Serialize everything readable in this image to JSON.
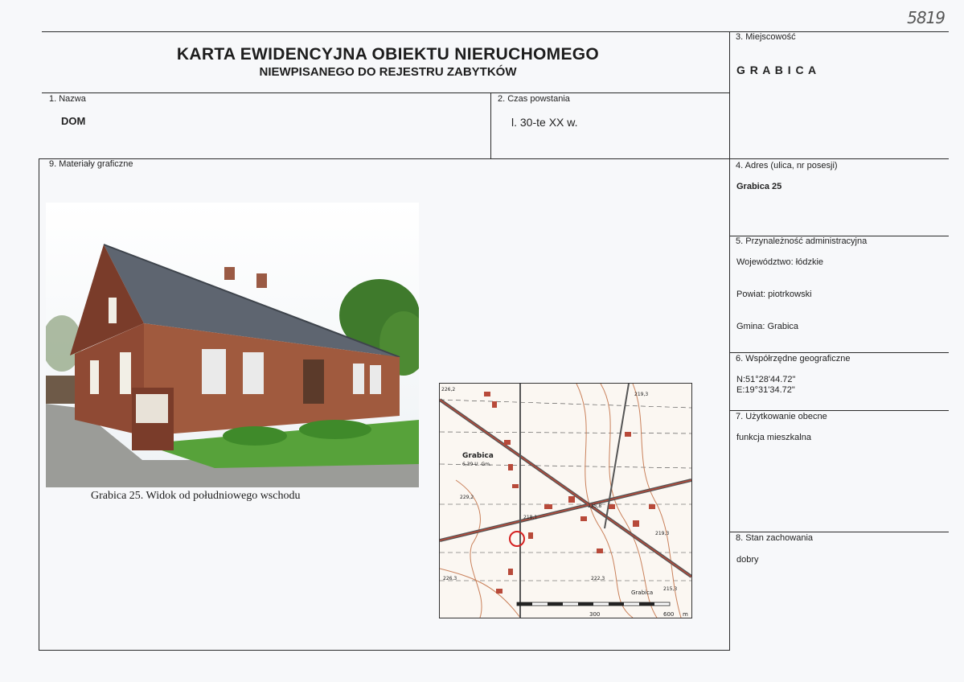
{
  "sheet_number": "5819",
  "header": {
    "title": "KARTA EWIDENCYJNA OBIEKTU NIERUCHOMEGO",
    "subtitle": "NIEWPISANEGO DO REJESTRU ZABYTKÓW"
  },
  "fields": {
    "nazwa": {
      "label": "1. Nazwa",
      "value": "DOM"
    },
    "czas": {
      "label": "2. Czas powstania",
      "value": "l. 30-te  XX w."
    },
    "miejscowosc": {
      "label": "3. Miejscowość",
      "value": "G R A B I C A"
    },
    "adres": {
      "label": "4. Adres (ulica, nr posesji)",
      "value": "Grabica 25"
    },
    "przynaleznosc": {
      "label": "5. Przynależność administracyjna",
      "wojewodztwo": "Województwo: łódzkie",
      "powiat": "Powiat: piotrkowski",
      "gmina": "Gmina: Grabica"
    },
    "wspolrzedne": {
      "label": "6. Współrzędne geograficzne",
      "n": "N:51°28'44.72\"",
      "e": "E:19°31'34.72\""
    },
    "uzytkowanie": {
      "label": "7. Użytkowanie obecne",
      "value": "funkcja mieszkalna"
    },
    "stan": {
      "label": "8. Stan zachowania",
      "value": "dobry"
    },
    "materialy": {
      "label": "9. Materiały graficzne"
    }
  },
  "photo": {
    "caption": "Grabica 25. Widok od południowego wschodu"
  },
  "map": {
    "place_label": "Grabica",
    "place_sublabel": "6,39 U. Gm.",
    "village_label": "Grabica",
    "elevations": [
      "226,2",
      "219,3",
      "229,2",
      "218,1",
      "225,8",
      "219,3",
      "226,3",
      "222,3",
      "215,3"
    ],
    "scale_labels": [
      "300",
      "600",
      "m"
    ]
  },
  "colors": {
    "line": "#2a2a2a",
    "map_road": "#b84a3a",
    "map_contour": "#c9805a",
    "map_marker": "#d42020"
  }
}
